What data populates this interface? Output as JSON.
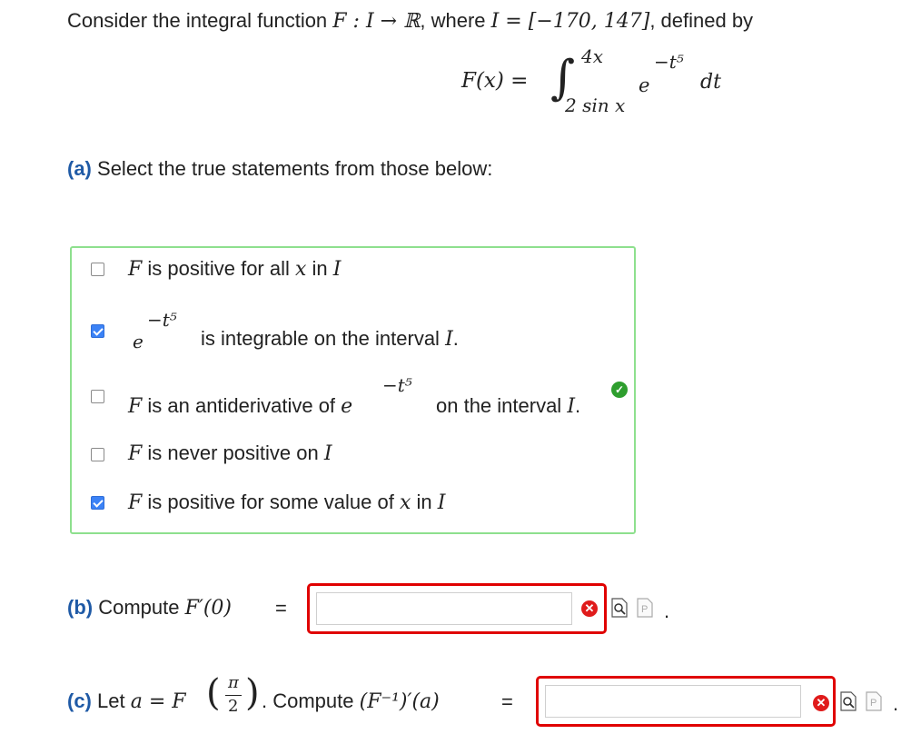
{
  "intro": {
    "text_before": "Consider the integral function ",
    "function_domain": "F : I → ℝ",
    "where": ", where ",
    "interval": "I = [−170, 147]",
    "defined_by": ", defined by"
  },
  "integral": {
    "lhs": "F(x) =",
    "upper": "4x",
    "lower": "2 sin x",
    "integrand_base": "e",
    "integrand_exp": "−t⁵",
    "differential": "dt"
  },
  "part_a": {
    "label": "(a)",
    "prompt": "Select the true statements from those below:",
    "options": [
      {
        "math": "F",
        "text": " is positive for all ",
        "math2": "x",
        "text2": " in ",
        "math3": "I",
        "checked": false
      },
      {
        "math": "e",
        "exp": "−t⁵",
        "text": " is integrable on the interval ",
        "math2": "I",
        "text2": ".",
        "checked": true
      },
      {
        "math": "F",
        "text": " is an antiderivative of ",
        "math2": "e",
        "exp": "−t⁵",
        "text2": " on the interval ",
        "math3": "I",
        "text3": ".",
        "checked": false
      },
      {
        "math": "F",
        "text": " is never positive on ",
        "math2": "I",
        "checked": false
      },
      {
        "math": "F",
        "text": " is positive for some value of ",
        "math2": "x",
        "text2": " in ",
        "math3": "I",
        "checked": true
      }
    ],
    "status": "correct"
  },
  "part_b": {
    "label": "(b)",
    "text": " Compute ",
    "expr": "F′(0)",
    "equals": "=",
    "value": "",
    "status": "incorrect",
    "trailing": "."
  },
  "part_c": {
    "label": "(c)",
    "text": " Let ",
    "a_def": "a = F",
    "frac_num": "π",
    "frac_den": "2",
    "compute": ". Compute ",
    "expr": "(F⁻¹)′(a)",
    "equals": "=",
    "value": "",
    "status": "incorrect",
    "trailing": "."
  },
  "colors": {
    "accent": "#1f5aa6",
    "correct_border": "#8ee08e",
    "incorrect_border": "#e00000",
    "checkbox_on": "#3b82f6"
  },
  "icons": [
    "check-circle-icon",
    "x-circle-icon",
    "preview-doc-icon",
    "help-doc-icon"
  ]
}
